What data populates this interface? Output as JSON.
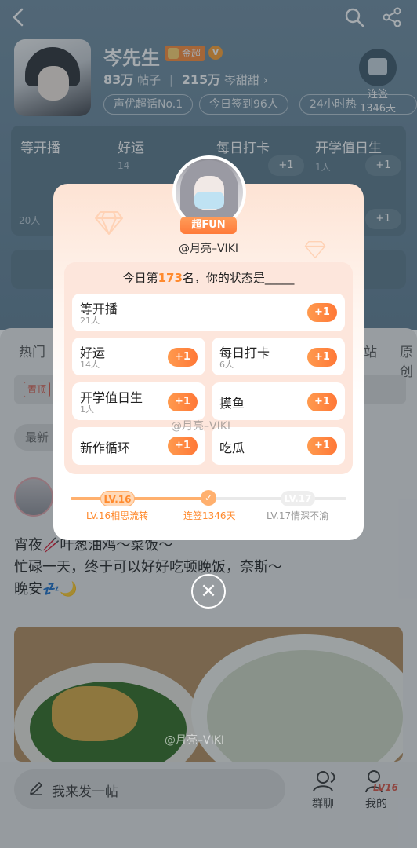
{
  "header": {
    "profile_name": "岑先生",
    "gold_badge": "金超",
    "verified_mark": "V",
    "posts_count": "83万",
    "posts_label": "帖子",
    "fans_count": "215万",
    "fans_label": "岑甜甜",
    "tags": [
      "声优超话No.1",
      "今日签到96人",
      "24小时热"
    ],
    "signin_label": "连签",
    "signin_days": "1346天"
  },
  "task_board": {
    "columns": [
      "等开播",
      "好运",
      "每日打卡",
      "开学值日生"
    ],
    "plus_label": "+1",
    "counts_visible": [
      "14",
      "1人",
      "20人"
    ]
  },
  "tabs": [
    "热门",
    "站",
    "原创"
  ],
  "pinned_tag": "置顶",
  "sort_label": "最新",
  "post": {
    "line1": "宵夜🥢叶葱油鸡～菜饭～",
    "line2": "忙碌一天，终于可以好好吃顿晚饭，奈斯～",
    "line3": "晚安💤🌙"
  },
  "bottom": {
    "compose_placeholder": "我来发一帖",
    "group_chat_label": "群聊",
    "mine_label": "我的",
    "mine_level": "LV16"
  },
  "popup": {
    "fun_badge": "超FUN",
    "username": "@月亮–VIKI",
    "question_prefix": "今日第",
    "rank": "173",
    "question_suffix": "名，你的状态是_____",
    "options": [
      {
        "title": "等开播",
        "count": "21人",
        "plus": "+1"
      },
      {
        "title": "好运",
        "count": "14人",
        "plus": "+1"
      },
      {
        "title": "每日打卡",
        "count": "6人",
        "plus": "+1"
      },
      {
        "title": "开学值日生",
        "count": "1人",
        "plus": "+1"
      },
      {
        "title": "摸鱼",
        "count": "",
        "plus": "+1"
      },
      {
        "title": "新作循环",
        "count": "",
        "plus": "+1"
      },
      {
        "title": "吃瓜",
        "count": "",
        "plus": "+1"
      }
    ],
    "level_current": "LV.16",
    "level_current_desc": "LV.16相思流转",
    "streak_label": "连签1346天",
    "level_next": "LV.17",
    "level_next_desc": "LV.17情深不渝",
    "close_symbol": "×"
  },
  "watermarks": [
    "@月亮–VIKI",
    "@月亮–VIKI"
  ],
  "colors": {
    "accent_orange": "#ff7837",
    "header_blue": "#5f7d92"
  }
}
